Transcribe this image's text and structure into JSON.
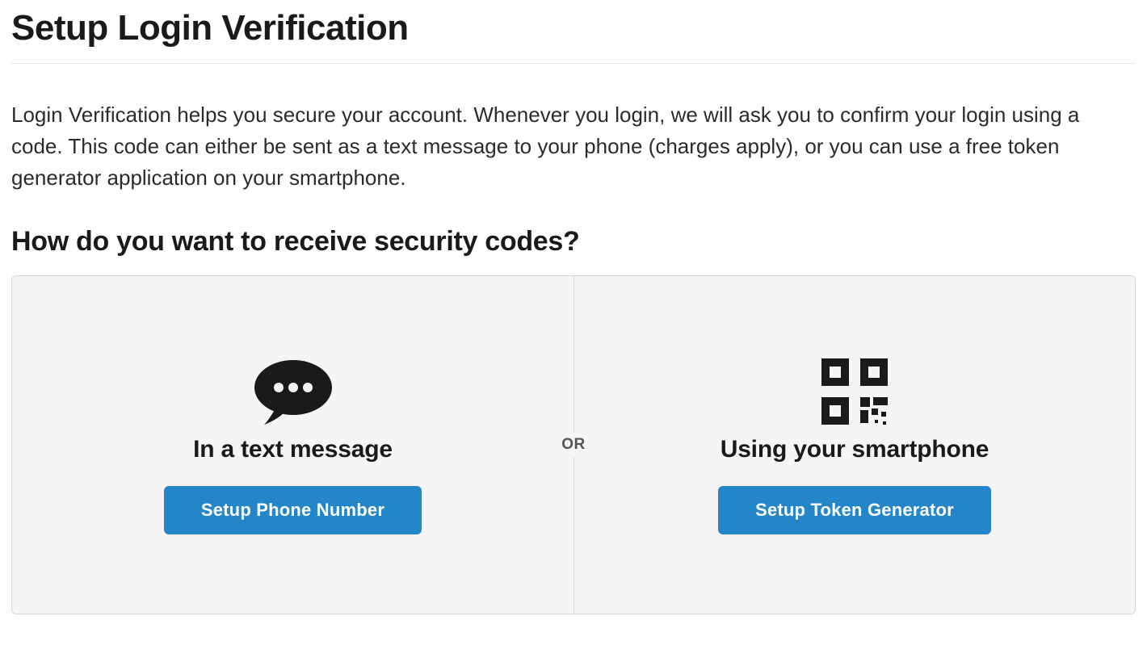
{
  "page": {
    "title": "Setup Login Verification",
    "intro": "Login Verification helps you secure your account. Whenever you login, we will ask you to confirm your login using a code. This code can either be sent as a text message to your phone (charges apply), or you can use a free token generator application on your smartphone.",
    "subheading": "How do you want to receive security codes?",
    "or_label": "OR"
  },
  "options": {
    "text_message": {
      "icon": "speech-bubble-icon",
      "title": "In a text message",
      "button_label": "Setup Phone Number"
    },
    "smartphone": {
      "icon": "qr-code-icon",
      "title": "Using your smartphone",
      "button_label": "Setup Token Generator"
    }
  },
  "colors": {
    "button_primary": "#2486c8",
    "panel_bg": "#f5f5f5",
    "panel_border": "#d6d6d6",
    "text": "#1a1a1a"
  }
}
